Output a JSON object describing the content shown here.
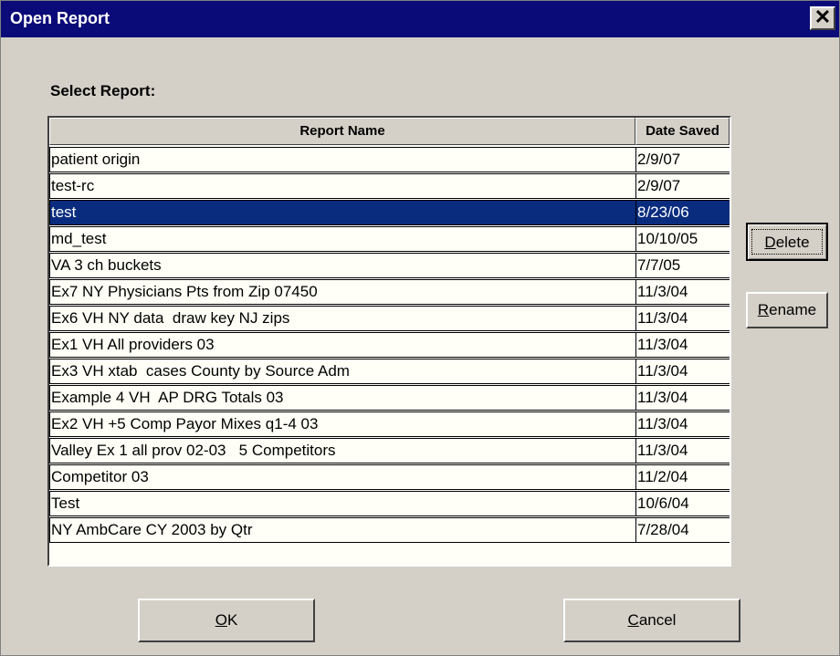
{
  "window": {
    "title": "Open Report",
    "close_glyph": "✕"
  },
  "select_label": "Select Report:",
  "columns": {
    "name": "Report Name",
    "date": "Date Saved"
  },
  "rows": [
    {
      "name": "patient origin",
      "date": "2/9/07"
    },
    {
      "name": "test-rc",
      "date": "2/9/07"
    },
    {
      "name": "test",
      "date": "8/23/06",
      "selected": true
    },
    {
      "name": "md_test",
      "date": "10/10/05"
    },
    {
      "name": "VA 3 ch buckets",
      "date": "7/7/05"
    },
    {
      "name": "Ex7 NY Physicians Pts from Zip 07450",
      "date": "11/3/04"
    },
    {
      "name": "Ex6 VH NY data  draw key NJ zips",
      "date": "11/3/04"
    },
    {
      "name": "Ex1 VH All providers 03",
      "date": "11/3/04"
    },
    {
      "name": "Ex3 VH xtab  cases County by Source Adm",
      "date": "11/3/04"
    },
    {
      "name": "Example 4 VH  AP DRG Totals 03",
      "date": "11/3/04"
    },
    {
      "name": "Ex2 VH +5 Comp Payor Mixes q1-4 03",
      "date": "11/3/04"
    },
    {
      "name": "Valley Ex 1 all prov 02-03   5 Competitors",
      "date": "11/3/04"
    },
    {
      "name": "Competitor 03",
      "date": "11/2/04"
    },
    {
      "name": "Test",
      "date": "10/6/04"
    },
    {
      "name": "NY AmbCare CY 2003 by Qtr",
      "date": "7/28/04"
    }
  ],
  "buttons": {
    "delete": {
      "mnemonic": "D",
      "rest": "elete"
    },
    "rename": {
      "mnemonic": "R",
      "rest": "ename"
    },
    "ok": {
      "mnemonic": "O",
      "rest": "K"
    },
    "cancel": {
      "mnemonic": "C",
      "rest": "ancel"
    }
  },
  "colors": {
    "titlebar": "#0a0a78",
    "selection": "#0a2c7e",
    "face": "#d4d0c8",
    "list_bg": "#fffff7"
  }
}
